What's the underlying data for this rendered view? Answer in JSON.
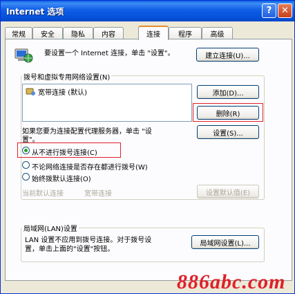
{
  "window": {
    "title": "Internet 选项",
    "help_label": "?",
    "close_label": "✕"
  },
  "tabs": [
    {
      "label": "常规"
    },
    {
      "label": "安全"
    },
    {
      "label": "隐私"
    },
    {
      "label": "内容"
    },
    {
      "label": "连接"
    },
    {
      "label": "程序"
    },
    {
      "label": "高级"
    }
  ],
  "active_tab": "连接",
  "setup": {
    "text": "要设置一个 Internet 连接，单击 \"设置\"。",
    "button": "建立连接(U)..."
  },
  "dialup": {
    "group_label": "拨号和虚拟专用网络设置(N)",
    "items": [
      {
        "label": "宽带连接 (默认)"
      }
    ],
    "add_button": "添加(D)...",
    "delete_button": "删除(R)",
    "proxy_text_line1": "如果您要为连接配置代理服务器，单击 \"设",
    "proxy_text_line2": "置\"。",
    "settings_button": "设置(S)...",
    "options": [
      {
        "label": "从不进行拨号连接(C)",
        "checked": true
      },
      {
        "label": "不论网络连接是否存在都进行拨号(W)",
        "checked": false
      },
      {
        "label": "始终拨默认连接(O)",
        "checked": false
      }
    ],
    "current_default_label": "当前默认连接",
    "current_default_value": "宽带连接",
    "set_default_button": "设置默认值(E)"
  },
  "lan": {
    "group_label": "局域网(LAN)设置",
    "text_line1": "LAN 设置不应用到拨号连接。对于拨号设",
    "text_line2": "置，单击上面的\"设置\"按钮。",
    "button": "局域网设置(L)..."
  },
  "watermark": "886abc.com",
  "colors": {
    "titlebar": "#0f5ee6",
    "highlight_box": "#e0202a",
    "watermark": "#e0202a"
  }
}
